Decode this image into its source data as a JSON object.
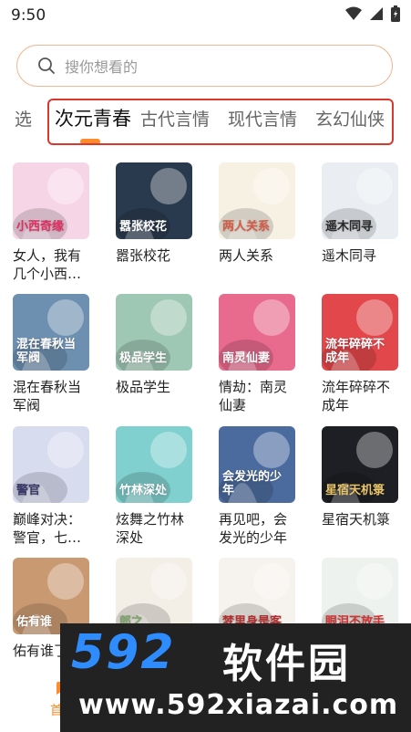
{
  "status": {
    "time": "9:50"
  },
  "search": {
    "placeholder": "搜你想看的"
  },
  "tabs": [
    {
      "label": "选",
      "active": false
    },
    {
      "label": "次元青春",
      "active": true
    },
    {
      "label": "古代言情",
      "active": false
    },
    {
      "label": "现代言情",
      "active": false
    },
    {
      "label": "玄幻仙侠",
      "active": false
    }
  ],
  "books": [
    {
      "title": "女人，我有几个小西…",
      "cover": "小西奇缘",
      "bg": "#f6d6e6",
      "fg": "#e02f62"
    },
    {
      "title": "嚣张校花",
      "cover": "嚣张校花",
      "bg": "#2a3a4e",
      "fg": "#ffffff"
    },
    {
      "title": "两人关系",
      "cover": "两人关系",
      "bg": "#f7f1e4",
      "fg": "#d65b44"
    },
    {
      "title": "遥木同寻",
      "cover": "遥木同寻",
      "bg": "#eaeef2",
      "fg": "#2a2a2a"
    },
    {
      "title": "混在春秋当军阀",
      "cover": "混在春秋当军阀",
      "bg": "#6d8fb0",
      "fg": "#ffffff"
    },
    {
      "title": "极品学生",
      "cover": "极品学生",
      "bg": "#9ec7b4",
      "fg": "#ffffff"
    },
    {
      "title": "情劫：南灵仙妻",
      "cover": "南灵仙妻",
      "bg": "#e86a8d",
      "fg": "#ffffff"
    },
    {
      "title": "流年碎碎不成年",
      "cover": "流年碎碎不成年",
      "bg": "#e2474b",
      "fg": "#ffffff"
    },
    {
      "title": "巅峰对决：警官，七…",
      "cover": "警官",
      "bg": "#d8dcef",
      "fg": "#3a3a6a"
    },
    {
      "title": "炫舞之竹林深处",
      "cover": "竹林深处",
      "bg": "#7fd0cf",
      "fg": "#ffffff"
    },
    {
      "title": "再见吧，会发光的少年",
      "cover": "会发光的少年",
      "bg": "#4b6b9e",
      "fg": "#ffffff"
    },
    {
      "title": "星宿天机箓",
      "cover": "星宿天机箓",
      "bg": "#1e1f24",
      "fg": "#e7c46a"
    },
    {
      "title": "佑有谁了",
      "cover": "佑有谁",
      "bg": "#c99a72",
      "fg": "#ffffff"
    },
    {
      "title": "",
      "cover": "郎之",
      "bg": "#f3eee6",
      "fg": "#7aa36a"
    },
    {
      "title": "",
      "cover": "梦里身是客",
      "bg": "#f6f2ee",
      "fg": "#b43030"
    },
    {
      "title": "",
      "cover": "眼泪不放手",
      "bg": "#eef2ee",
      "fg": "#d23232"
    }
  ],
  "bottom_nav": {
    "home_label": "首"
  },
  "watermark": {
    "logo": "592",
    "name": "软件园",
    "url": "www.592xiazai.com"
  },
  "colors": {
    "accent": "#ff8b2b",
    "highlight_box": "#d9382e",
    "search_border": "#f3b892"
  }
}
